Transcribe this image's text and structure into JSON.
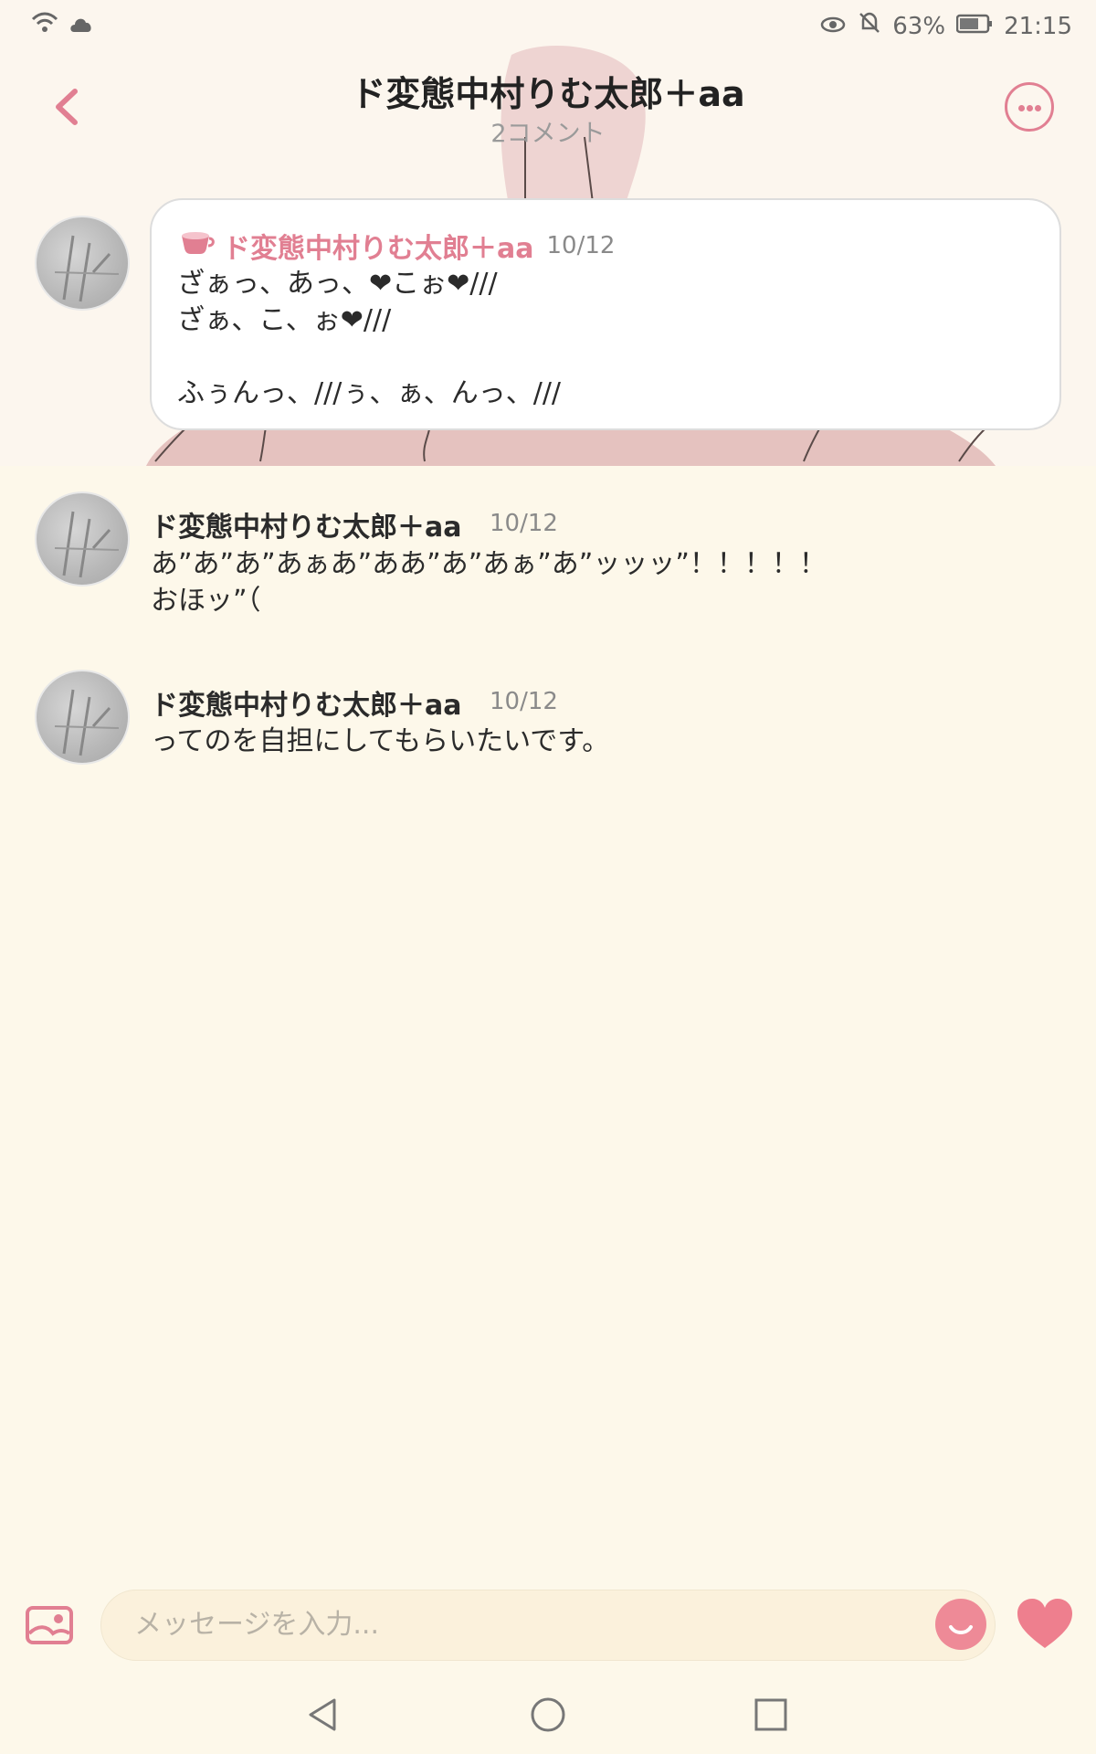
{
  "status_bar": {
    "battery": "63%",
    "time": "21:15"
  },
  "header": {
    "title": "ド変態中村りむ太郎＋aa",
    "subtitle": "2コメント"
  },
  "highlight_comment": {
    "author": "ド変態中村りむ太郎＋aa",
    "date": "10/12",
    "text": "ざぁっ、あっ、❤こぉ❤///\nざぁ、こ、ぉ❤///\n\nふぅんっ、///ぅ、ぁ、んっ、///"
  },
  "comments": [
    {
      "author": "ド変態中村りむ太郎＋aa",
      "date": "10/12",
      "text": "あ”あ”あ”あぁあ”ああ”あ”あぁ”あ”ッッッ”！！！！！\nおほッ”（"
    },
    {
      "author": "ド変態中村りむ太郎＋aa",
      "date": "10/12",
      "text": "ってのを自担にしてもらいたいです。"
    }
  ],
  "input": {
    "placeholder": "メッセージを入力..."
  },
  "colors": {
    "accent": "#e17f92",
    "background": "#fdf8ea",
    "input_bg": "#fbf1dc"
  }
}
